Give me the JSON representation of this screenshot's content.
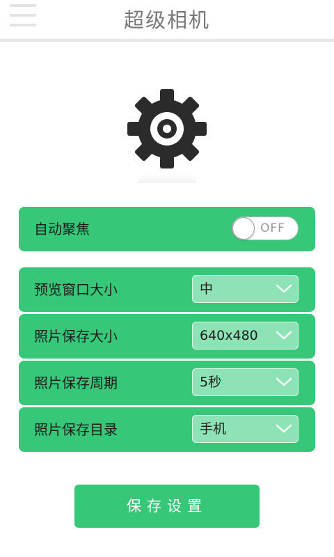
{
  "header": {
    "title": "超级相机"
  },
  "settings": {
    "autofocus": {
      "label": "自动聚焦",
      "toggle_text": "OFF"
    },
    "rows": [
      {
        "label": "预览窗口大小",
        "value": "中"
      },
      {
        "label": "照片保存大小",
        "value": "640x480"
      },
      {
        "label": "照片保存周期",
        "value": "5秒"
      },
      {
        "label": "照片保存目录",
        "value": "手机"
      }
    ]
  },
  "save_button": {
    "label": "保存设置"
  },
  "colors": {
    "accent": "#36c778",
    "select_bg": "#8ee3b6",
    "gear": "#2b2b2b"
  },
  "icons": {
    "menu": "menu-icon",
    "settings": "gear-icon",
    "dropdown": "chevron-down-icon"
  }
}
